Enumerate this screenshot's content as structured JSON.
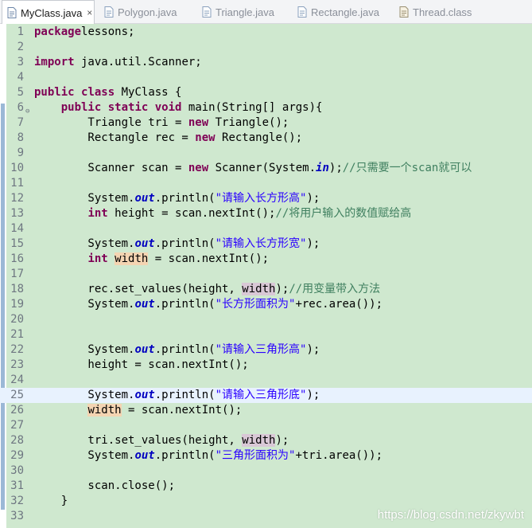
{
  "tabs": [
    {
      "label": "MyClass.java",
      "icon": "java-file-icon",
      "active": true,
      "close": "×"
    },
    {
      "label": "Polygon.java",
      "icon": "java-file-icon",
      "active": false
    },
    {
      "label": "Triangle.java",
      "icon": "java-file-icon",
      "active": false
    },
    {
      "label": "Rectangle.java",
      "icon": "java-file-icon",
      "active": false
    },
    {
      "label": "Thread.class",
      "icon": "class-file-icon",
      "active": false
    }
  ],
  "editor": {
    "current_line": 25,
    "lines": [
      {
        "n": "1",
        "tokens": [
          [
            "kw",
            "package"
          ],
          [
            "",
            "lessons;"
          ]
        ]
      },
      {
        "n": "2",
        "tokens": []
      },
      {
        "n": "3",
        "tokens": [
          [
            "kw",
            "import"
          ],
          [
            "",
            " java.util.Scanner;"
          ]
        ]
      },
      {
        "n": "4",
        "tokens": []
      },
      {
        "n": "5",
        "tokens": [
          [
            "kw",
            "public"
          ],
          [
            "",
            " "
          ],
          [
            "kw",
            "class"
          ],
          [
            "",
            " MyClass {"
          ]
        ]
      },
      {
        "n": "6",
        "tokens": [
          [
            "",
            "    "
          ],
          [
            "kw",
            "public"
          ],
          [
            "",
            " "
          ],
          [
            "kw",
            "static"
          ],
          [
            "",
            " "
          ],
          [
            "kw",
            "void"
          ],
          [
            "",
            " main(String[] args){"
          ]
        ]
      },
      {
        "n": "7",
        "tokens": [
          [
            "",
            "        Triangle tri = "
          ],
          [
            "kw",
            "new"
          ],
          [
            "",
            " Triangle();"
          ]
        ]
      },
      {
        "n": "8",
        "tokens": [
          [
            "",
            "        Rectangle rec = "
          ],
          [
            "kw",
            "new"
          ],
          [
            "",
            " Rectangle();"
          ]
        ]
      },
      {
        "n": "9",
        "tokens": []
      },
      {
        "n": "10",
        "tokens": [
          [
            "",
            "        Scanner scan = "
          ],
          [
            "kw",
            "new"
          ],
          [
            "",
            " Scanner(System."
          ],
          [
            "fld",
            "in"
          ],
          [
            "",
            ");"
          ],
          [
            "cmt",
            "//只需要一个scan就可以"
          ]
        ]
      },
      {
        "n": "11",
        "tokens": []
      },
      {
        "n": "12",
        "tokens": [
          [
            "",
            "        System."
          ],
          [
            "fld",
            "out"
          ],
          [
            "",
            ".println("
          ],
          [
            "str",
            "\"请输入长方形高\""
          ],
          [
            "",
            ");"
          ]
        ]
      },
      {
        "n": "13",
        "tokens": [
          [
            "",
            "        "
          ],
          [
            "kw",
            "int"
          ],
          [
            "",
            " height = scan.nextInt();"
          ],
          [
            "cmt",
            "//将用户输入的数值赋给高"
          ]
        ]
      },
      {
        "n": "14",
        "tokens": []
      },
      {
        "n": "15",
        "tokens": [
          [
            "",
            "        System."
          ],
          [
            "fld",
            "out"
          ],
          [
            "",
            ".println("
          ],
          [
            "str",
            "\"请输入长方形宽\""
          ],
          [
            "",
            ");"
          ]
        ]
      },
      {
        "n": "16",
        "tokens": [
          [
            "",
            "        "
          ],
          [
            "kw",
            "int"
          ],
          [
            "",
            " "
          ],
          [
            "hl1",
            "width"
          ],
          [
            "",
            " = scan.nextInt();"
          ]
        ]
      },
      {
        "n": "17",
        "tokens": []
      },
      {
        "n": "18",
        "tokens": [
          [
            "",
            "        rec.set_values(height, "
          ],
          [
            "hl2",
            "width"
          ],
          [
            "",
            ");"
          ],
          [
            "cmt",
            "//用变量带入方法"
          ]
        ]
      },
      {
        "n": "19",
        "tokens": [
          [
            "",
            "        System."
          ],
          [
            "fld",
            "out"
          ],
          [
            "",
            ".println("
          ],
          [
            "str",
            "\"长方形面积为\""
          ],
          [
            "",
            "+rec.area());"
          ]
        ]
      },
      {
        "n": "20",
        "tokens": []
      },
      {
        "n": "21",
        "tokens": []
      },
      {
        "n": "22",
        "tokens": [
          [
            "",
            "        System."
          ],
          [
            "fld",
            "out"
          ],
          [
            "",
            ".println("
          ],
          [
            "str",
            "\"请输入三角形高\""
          ],
          [
            "",
            ");"
          ]
        ]
      },
      {
        "n": "23",
        "tokens": [
          [
            "",
            "        height = scan.nextInt();"
          ]
        ]
      },
      {
        "n": "24",
        "tokens": []
      },
      {
        "n": "25",
        "tokens": [
          [
            "",
            "        System."
          ],
          [
            "fld",
            "out"
          ],
          [
            "",
            ".println("
          ],
          [
            "str",
            "\"请输入三角形底\""
          ],
          [
            "",
            ");"
          ]
        ]
      },
      {
        "n": "26",
        "tokens": [
          [
            "",
            "        "
          ],
          [
            "hl1",
            "width"
          ],
          [
            "",
            " = scan.nextInt();"
          ]
        ]
      },
      {
        "n": "27",
        "tokens": []
      },
      {
        "n": "28",
        "tokens": [
          [
            "",
            "        tri.set_values(height, "
          ],
          [
            "hl2",
            "width"
          ],
          [
            "",
            ");"
          ]
        ]
      },
      {
        "n": "29",
        "tokens": [
          [
            "",
            "        System."
          ],
          [
            "fld",
            "out"
          ],
          [
            "",
            ".println("
          ],
          [
            "str",
            "\"三角形面积为\""
          ],
          [
            "",
            "+tri.area());"
          ]
        ]
      },
      {
        "n": "30",
        "tokens": []
      },
      {
        "n": "31",
        "tokens": [
          [
            "",
            "        scan.close();"
          ]
        ]
      },
      {
        "n": "32",
        "tokens": [
          [
            "",
            "    }"
          ]
        ]
      },
      {
        "n": "33",
        "tokens": []
      }
    ]
  },
  "watermark": "https://blog.csdn.net/zkywbt",
  "colors": {
    "editor_bg": "#cfe8cf",
    "keyword": "#7f0055",
    "string": "#2a00ff",
    "comment": "#3f7f5f",
    "field": "#0000c0",
    "current_line": "#e8f2fe"
  }
}
